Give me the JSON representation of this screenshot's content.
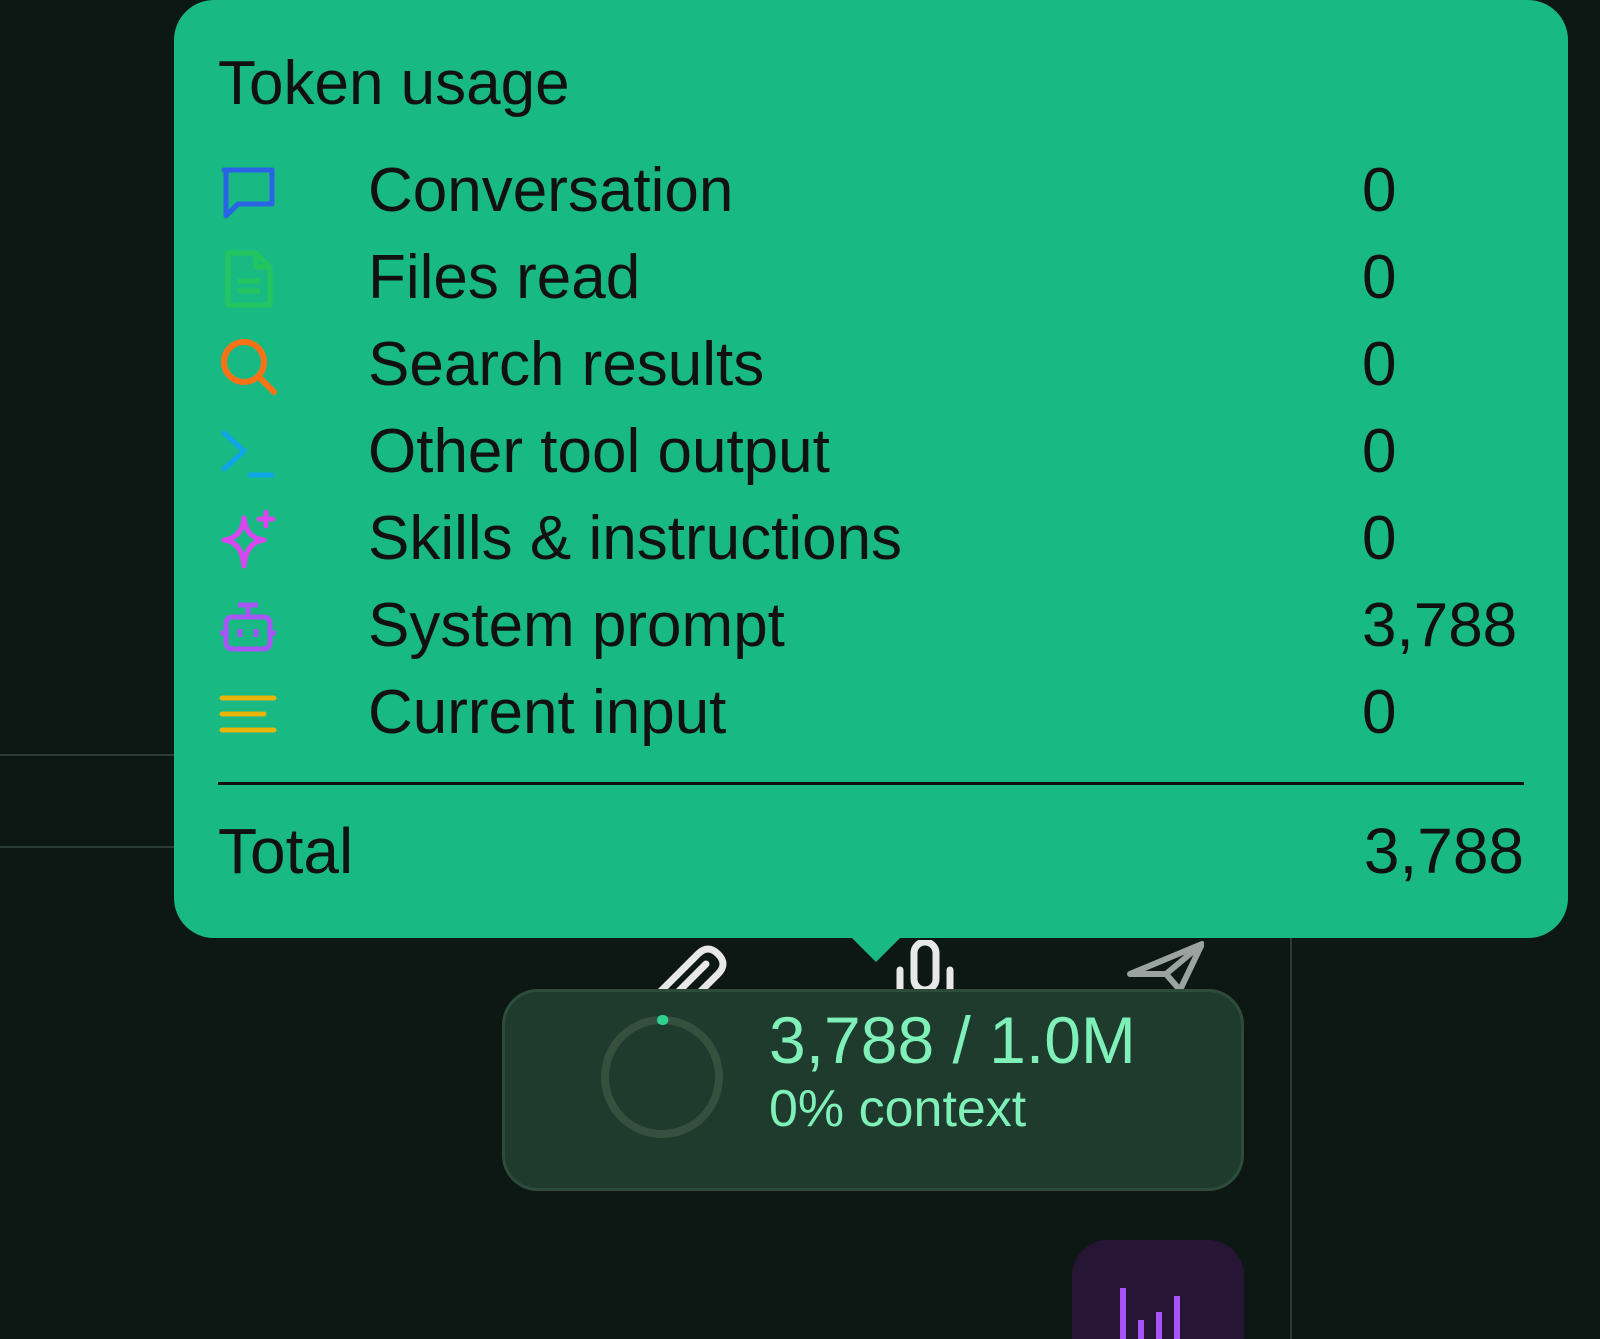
{
  "tooltip": {
    "title": "Token usage",
    "rows": [
      {
        "label": "Conversation",
        "value": "0",
        "icon": "chat-bubble-icon",
        "color": "#2b63e6"
      },
      {
        "label": "Files read",
        "value": "0",
        "icon": "document-icon",
        "color": "#22c55e"
      },
      {
        "label": "Search results",
        "value": "0",
        "icon": "search-icon",
        "color": "#f97316"
      },
      {
        "label": "Other tool output",
        "value": "0",
        "icon": "terminal-icon",
        "color": "#0ea5e9"
      },
      {
        "label": "Skills & instructions",
        "value": "0",
        "icon": "sparkle-icon",
        "color": "#d946ef"
      },
      {
        "label": "System prompt",
        "value": "3,788",
        "icon": "robot-icon",
        "color": "#a855f7"
      },
      {
        "label": "Current input",
        "value": "0",
        "icon": "lines-icon",
        "color": "#eab308"
      }
    ],
    "total_label": "Total",
    "total_value": "3,788",
    "background": "#18b983"
  },
  "toolbar": {
    "icons": [
      "paperclip-icon",
      "microphone-icon",
      "send-icon"
    ]
  },
  "context": {
    "count": "3,788 / 1.0M",
    "percent": "0% context",
    "fraction_used": 0.0038,
    "accent": "#7ef0b8"
  },
  "chart_button": {
    "icon": "bar-chart-icon",
    "color": "#a855f7"
  }
}
